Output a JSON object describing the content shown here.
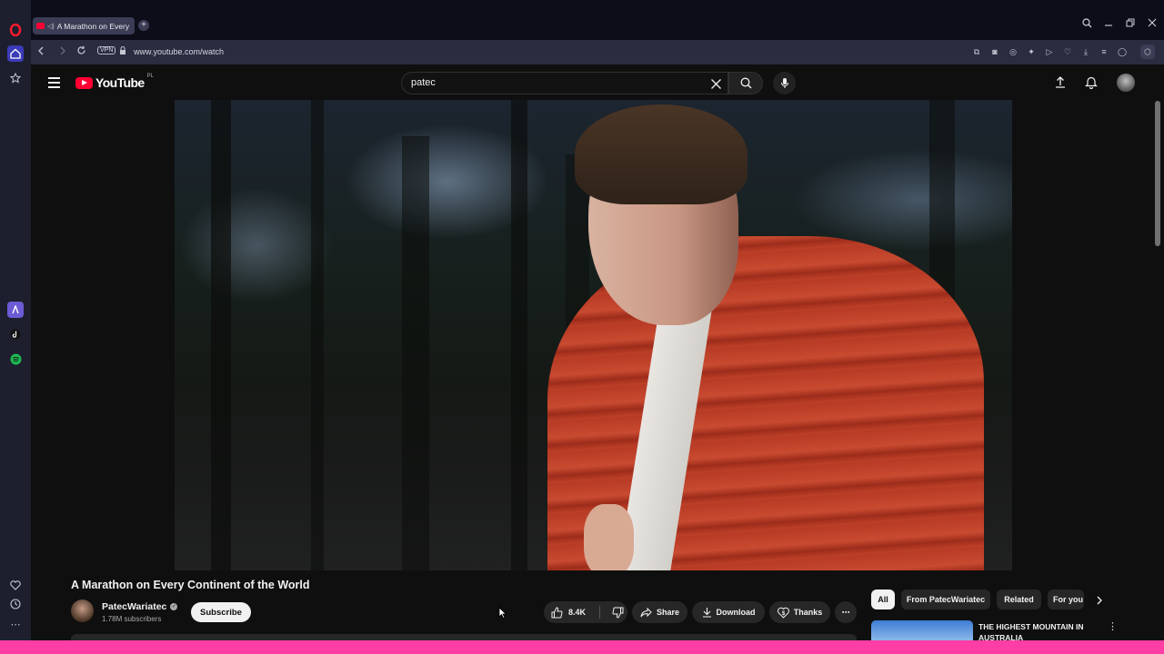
{
  "browser": {
    "tab_title": "A Marathon on Every",
    "new_tab_symbol": "+",
    "vpn_label": "VPN",
    "url": "www.youtube.com/watch"
  },
  "youtube": {
    "logo_text": "YouTube",
    "country_code": "PL",
    "search_value": "patec",
    "search_placeholder": "Search"
  },
  "video": {
    "title": "A Marathon on Every Continent of the World",
    "channel_name": "PatecWariatec",
    "subscribers": "1.78M subscribers",
    "subscribe_label": "Subscribe",
    "likes": "8.4K",
    "share_label": "Share",
    "download_label": "Download",
    "thanks_label": "Thanks"
  },
  "sidebar_chips": [
    "All",
    "From PatecWariatec",
    "Related",
    "For you"
  ],
  "recommended": [
    {
      "title": "THE HIGHEST MOUNTAIN IN AUSTRALIA"
    }
  ],
  "colors": {
    "yt_red": "#ff0033",
    "bottom_bar": "#ff3ea5",
    "opera_sidebar": "#1e1f2e"
  }
}
